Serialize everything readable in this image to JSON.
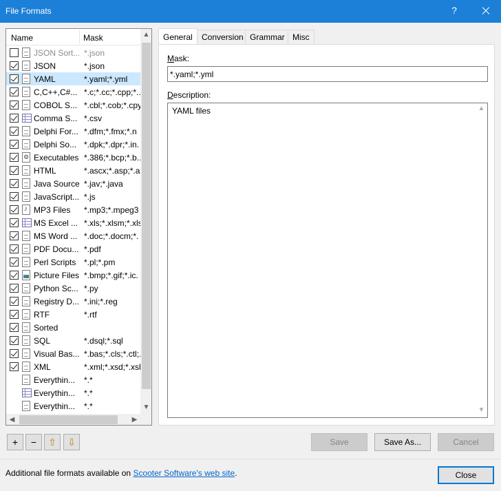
{
  "window": {
    "title": "File Formats",
    "help": "?"
  },
  "list": {
    "headers": {
      "name": "Name",
      "mask": "Mask"
    },
    "rows": [
      {
        "checked": false,
        "icon": "file-icon",
        "name": "JSON Sort...",
        "mask": "*.json",
        "dim": true
      },
      {
        "checked": true,
        "icon": "file-icon",
        "name": "JSON",
        "mask": "*.json"
      },
      {
        "checked": true,
        "icon": "file-icon",
        "name": "YAML",
        "mask": "*.yaml;*.yml",
        "selected": true
      },
      {
        "checked": true,
        "icon": "file-icon",
        "name": "C,C++,C#...",
        "mask": "*.c;*.cc;*.cpp;*..."
      },
      {
        "checked": true,
        "icon": "file-icon",
        "name": "COBOL S...",
        "mask": "*.cbl;*.cob;*.cpy"
      },
      {
        "checked": true,
        "icon": "table-icon",
        "name": "Comma S...",
        "mask": "*.csv"
      },
      {
        "checked": true,
        "icon": "file-icon",
        "name": "Delphi For...",
        "mask": "*.dfm;*.fmx;*.n"
      },
      {
        "checked": true,
        "icon": "file-icon",
        "name": "Delphi So...",
        "mask": "*.dpk;*.dpr;*.in."
      },
      {
        "checked": true,
        "icon": "gear-file-icon",
        "name": "Executables",
        "mask": "*.386;*.bcp;*.b..."
      },
      {
        "checked": true,
        "icon": "file-icon",
        "name": "HTML",
        "mask": "*.ascx;*.asp;*.a..."
      },
      {
        "checked": true,
        "icon": "file-icon",
        "name": "Java Source",
        "mask": "*.jav;*.java"
      },
      {
        "checked": true,
        "icon": "file-icon",
        "name": "JavaScript...",
        "mask": "*.js"
      },
      {
        "checked": true,
        "icon": "music-file-icon",
        "name": "MP3 Files",
        "mask": "*.mp3;*.mpeg3"
      },
      {
        "checked": true,
        "icon": "table-icon",
        "name": "MS Excel ...",
        "mask": "*.xls;*.xlsm;*.xls"
      },
      {
        "checked": true,
        "icon": "file-icon",
        "name": "MS Word ...",
        "mask": "*.doc;*.docm;*."
      },
      {
        "checked": true,
        "icon": "file-icon",
        "name": "PDF Docu...",
        "mask": "*.pdf"
      },
      {
        "checked": true,
        "icon": "file-icon",
        "name": "Perl Scripts",
        "mask": "*.pl;*.pm"
      },
      {
        "checked": true,
        "icon": "picture-file-icon",
        "name": "Picture Files",
        "mask": "*.bmp;*.gif;*.ic."
      },
      {
        "checked": true,
        "icon": "file-icon",
        "name": "Python Sc...",
        "mask": "*.py"
      },
      {
        "checked": true,
        "icon": "file-icon",
        "name": "Registry D...",
        "mask": "*.ini;*.reg"
      },
      {
        "checked": true,
        "icon": "file-icon",
        "name": "RTF",
        "mask": "*.rtf"
      },
      {
        "checked": true,
        "icon": "file-icon",
        "name": "Sorted",
        "mask": ""
      },
      {
        "checked": true,
        "icon": "file-icon",
        "name": "SQL",
        "mask": "*.dsql;*.sql"
      },
      {
        "checked": true,
        "icon": "file-icon",
        "name": "Visual Bas...",
        "mask": "*.bas;*.cls;*.ctl;."
      },
      {
        "checked": true,
        "icon": "file-icon",
        "name": "XML",
        "mask": "*.xml;*.xsd;*.xsl"
      },
      {
        "checked": null,
        "icon": "file-icon",
        "name": "Everythin...",
        "mask": "*.*"
      },
      {
        "checked": null,
        "icon": "table-icon",
        "name": "Everythin...",
        "mask": "*.*"
      },
      {
        "checked": null,
        "icon": "binary-file-icon",
        "name": "Everythin...",
        "mask": "*.*"
      }
    ]
  },
  "tabs": [
    "General",
    "Conversion",
    "Grammar",
    "Misc"
  ],
  "general": {
    "mask_label_u": "M",
    "mask_label_rest": "ask:",
    "mask_value": "*.yaml;*.yml",
    "desc_label_u": "D",
    "desc_label_rest": "escription:",
    "desc_value": "YAML files"
  },
  "toolbar": {
    "add": "+",
    "remove": "−",
    "up": "⇧",
    "down": "⇩"
  },
  "buttons": {
    "save": "Save",
    "save_as": "Save As...",
    "cancel": "Cancel",
    "close": "Close"
  },
  "footer": {
    "text": "Additional file formats available on ",
    "link": "Scooter Software's web site",
    "suffix": "."
  }
}
